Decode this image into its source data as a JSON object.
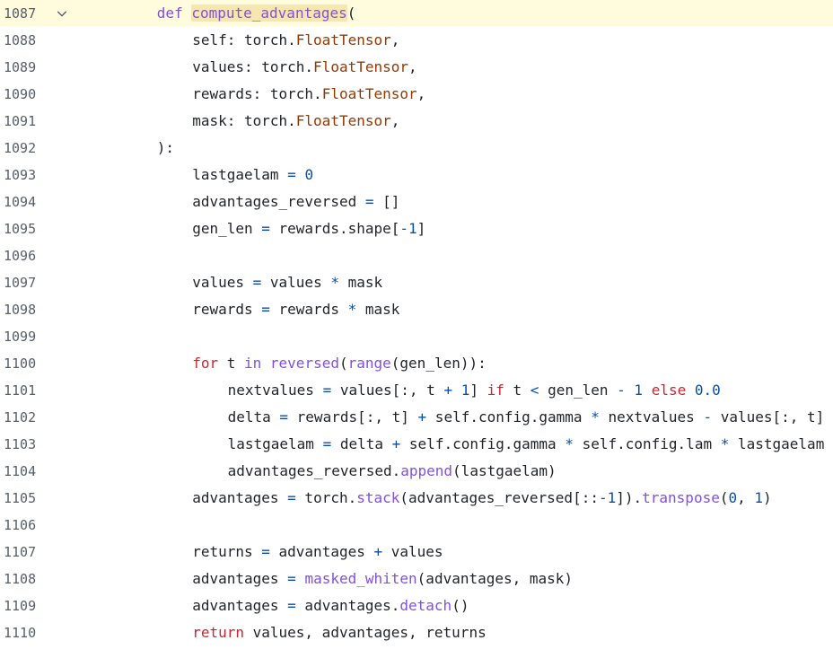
{
  "editor": {
    "lines": [
      {
        "number": "1087",
        "current": true,
        "fold": true,
        "indent": 8,
        "tokens": [
          {
            "t": "def",
            "c": "tok-def"
          },
          {
            "t": " ",
            "c": "tok-text"
          },
          {
            "t": "compute_advantages",
            "c": "tok-fn-hl"
          },
          {
            "t": "(",
            "c": "tok-text"
          }
        ]
      },
      {
        "number": "1088",
        "indent": 12,
        "tokens": [
          {
            "t": "self: torch.",
            "c": "tok-text"
          },
          {
            "t": "FloatTensor",
            "c": "tok-type"
          },
          {
            "t": ",",
            "c": "tok-text"
          }
        ]
      },
      {
        "number": "1089",
        "indent": 12,
        "tokens": [
          {
            "t": "values: torch.",
            "c": "tok-text"
          },
          {
            "t": "FloatTensor",
            "c": "tok-type"
          },
          {
            "t": ",",
            "c": "tok-text"
          }
        ]
      },
      {
        "number": "1090",
        "indent": 12,
        "tokens": [
          {
            "t": "rewards: torch.",
            "c": "tok-text"
          },
          {
            "t": "FloatTensor",
            "c": "tok-type"
          },
          {
            "t": ",",
            "c": "tok-text"
          }
        ]
      },
      {
        "number": "1091",
        "indent": 12,
        "tokens": [
          {
            "t": "mask: torch.",
            "c": "tok-text"
          },
          {
            "t": "FloatTensor",
            "c": "tok-type"
          },
          {
            "t": ",",
            "c": "tok-text"
          }
        ]
      },
      {
        "number": "1092",
        "indent": 8,
        "tokens": [
          {
            "t": "):",
            "c": "tok-text"
          }
        ]
      },
      {
        "number": "1093",
        "indent": 12,
        "tokens": [
          {
            "t": "lastgaelam ",
            "c": "tok-text"
          },
          {
            "t": "=",
            "c": "tok-op"
          },
          {
            "t": " ",
            "c": "tok-text"
          },
          {
            "t": "0",
            "c": "tok-num"
          }
        ]
      },
      {
        "number": "1094",
        "indent": 12,
        "tokens": [
          {
            "t": "advantages_reversed ",
            "c": "tok-text"
          },
          {
            "t": "=",
            "c": "tok-op"
          },
          {
            "t": " []",
            "c": "tok-text"
          }
        ]
      },
      {
        "number": "1095",
        "indent": 12,
        "tokens": [
          {
            "t": "gen_len ",
            "c": "tok-text"
          },
          {
            "t": "=",
            "c": "tok-op"
          },
          {
            "t": " rewards.shape[",
            "c": "tok-text"
          },
          {
            "t": "-1",
            "c": "tok-num"
          },
          {
            "t": "]",
            "c": "tok-text"
          }
        ]
      },
      {
        "number": "1096",
        "indent": 0,
        "tokens": []
      },
      {
        "number": "1097",
        "indent": 12,
        "tokens": [
          {
            "t": "values ",
            "c": "tok-text"
          },
          {
            "t": "=",
            "c": "tok-op"
          },
          {
            "t": " values ",
            "c": "tok-text"
          },
          {
            "t": "*",
            "c": "tok-op"
          },
          {
            "t": " mask",
            "c": "tok-text"
          }
        ]
      },
      {
        "number": "1098",
        "indent": 12,
        "tokens": [
          {
            "t": "rewards ",
            "c": "tok-text"
          },
          {
            "t": "=",
            "c": "tok-op"
          },
          {
            "t": " rewards ",
            "c": "tok-text"
          },
          {
            "t": "*",
            "c": "tok-op"
          },
          {
            "t": " mask",
            "c": "tok-text"
          }
        ]
      },
      {
        "number": "1099",
        "indent": 0,
        "tokens": []
      },
      {
        "number": "1100",
        "indent": 12,
        "tokens": [
          {
            "t": "for",
            "c": "tok-kw"
          },
          {
            "t": " t ",
            "c": "tok-text"
          },
          {
            "t": "in",
            "c": "tok-def"
          },
          {
            "t": " ",
            "c": "tok-text"
          },
          {
            "t": "reversed",
            "c": "tok-fn"
          },
          {
            "t": "(",
            "c": "tok-text"
          },
          {
            "t": "range",
            "c": "tok-fn"
          },
          {
            "t": "(gen_len)):",
            "c": "tok-text"
          }
        ]
      },
      {
        "number": "1101",
        "indent": 16,
        "tokens": [
          {
            "t": "nextvalues ",
            "c": "tok-text"
          },
          {
            "t": "=",
            "c": "tok-op"
          },
          {
            "t": " values[:, t ",
            "c": "tok-text"
          },
          {
            "t": "+",
            "c": "tok-op"
          },
          {
            "t": " ",
            "c": "tok-text"
          },
          {
            "t": "1",
            "c": "tok-num"
          },
          {
            "t": "] ",
            "c": "tok-text"
          },
          {
            "t": "if",
            "c": "tok-kw"
          },
          {
            "t": " t ",
            "c": "tok-text"
          },
          {
            "t": "<",
            "c": "tok-op"
          },
          {
            "t": " gen_len ",
            "c": "tok-text"
          },
          {
            "t": "-",
            "c": "tok-op"
          },
          {
            "t": " ",
            "c": "tok-text"
          },
          {
            "t": "1",
            "c": "tok-num"
          },
          {
            "t": " ",
            "c": "tok-text"
          },
          {
            "t": "else",
            "c": "tok-kw"
          },
          {
            "t": " ",
            "c": "tok-text"
          },
          {
            "t": "0.0",
            "c": "tok-num"
          }
        ]
      },
      {
        "number": "1102",
        "indent": 16,
        "tokens": [
          {
            "t": "delta ",
            "c": "tok-text"
          },
          {
            "t": "=",
            "c": "tok-op"
          },
          {
            "t": " rewards[:, t] ",
            "c": "tok-text"
          },
          {
            "t": "+",
            "c": "tok-op"
          },
          {
            "t": " self.config.gamma ",
            "c": "tok-text"
          },
          {
            "t": "*",
            "c": "tok-op"
          },
          {
            "t": " nextvalues ",
            "c": "tok-text"
          },
          {
            "t": "-",
            "c": "tok-op"
          },
          {
            "t": " values[:, t]",
            "c": "tok-text"
          }
        ]
      },
      {
        "number": "1103",
        "indent": 16,
        "tokens": [
          {
            "t": "lastgaelam ",
            "c": "tok-text"
          },
          {
            "t": "=",
            "c": "tok-op"
          },
          {
            "t": " delta ",
            "c": "tok-text"
          },
          {
            "t": "+",
            "c": "tok-op"
          },
          {
            "t": " self.config.gamma ",
            "c": "tok-text"
          },
          {
            "t": "*",
            "c": "tok-op"
          },
          {
            "t": " self.config.lam ",
            "c": "tok-text"
          },
          {
            "t": "*",
            "c": "tok-op"
          },
          {
            "t": " lastgaelam",
            "c": "tok-text"
          }
        ]
      },
      {
        "number": "1104",
        "indent": 16,
        "tokens": [
          {
            "t": "advantages_reversed.",
            "c": "tok-text"
          },
          {
            "t": "append",
            "c": "tok-fn"
          },
          {
            "t": "(lastgaelam)",
            "c": "tok-text"
          }
        ]
      },
      {
        "number": "1105",
        "indent": 12,
        "tokens": [
          {
            "t": "advantages ",
            "c": "tok-text"
          },
          {
            "t": "=",
            "c": "tok-op"
          },
          {
            "t": " torch.",
            "c": "tok-text"
          },
          {
            "t": "stack",
            "c": "tok-fn"
          },
          {
            "t": "(advantages_reversed[::",
            "c": "tok-text"
          },
          {
            "t": "-1",
            "c": "tok-num"
          },
          {
            "t": "]).",
            "c": "tok-text"
          },
          {
            "t": "transpose",
            "c": "tok-fn"
          },
          {
            "t": "(",
            "c": "tok-text"
          },
          {
            "t": "0",
            "c": "tok-num"
          },
          {
            "t": ", ",
            "c": "tok-text"
          },
          {
            "t": "1",
            "c": "tok-num"
          },
          {
            "t": ")",
            "c": "tok-text"
          }
        ]
      },
      {
        "number": "1106",
        "indent": 0,
        "tokens": []
      },
      {
        "number": "1107",
        "indent": 12,
        "tokens": [
          {
            "t": "returns ",
            "c": "tok-text"
          },
          {
            "t": "=",
            "c": "tok-op"
          },
          {
            "t": " advantages ",
            "c": "tok-text"
          },
          {
            "t": "+",
            "c": "tok-op"
          },
          {
            "t": " values",
            "c": "tok-text"
          }
        ]
      },
      {
        "number": "1108",
        "indent": 12,
        "tokens": [
          {
            "t": "advantages ",
            "c": "tok-text"
          },
          {
            "t": "=",
            "c": "tok-op"
          },
          {
            "t": " ",
            "c": "tok-text"
          },
          {
            "t": "masked_whiten",
            "c": "tok-fn"
          },
          {
            "t": "(advantages, mask)",
            "c": "tok-text"
          }
        ]
      },
      {
        "number": "1109",
        "indent": 12,
        "tokens": [
          {
            "t": "advantages ",
            "c": "tok-text"
          },
          {
            "t": "=",
            "c": "tok-op"
          },
          {
            "t": " advantages.",
            "c": "tok-text"
          },
          {
            "t": "detach",
            "c": "tok-fn"
          },
          {
            "t": "()",
            "c": "tok-text"
          }
        ]
      },
      {
        "number": "1110",
        "indent": 12,
        "tokens": [
          {
            "t": "return",
            "c": "tok-kw"
          },
          {
            "t": " values, advantages, returns",
            "c": "tok-text"
          }
        ]
      }
    ],
    "fold_icon": "chevron-down-icon",
    "colors": {
      "current_line_bg": "#fffbdd",
      "keyword": "#cf222e",
      "function": "#8250df",
      "type": "#953800",
      "number": "#0550ae"
    }
  }
}
